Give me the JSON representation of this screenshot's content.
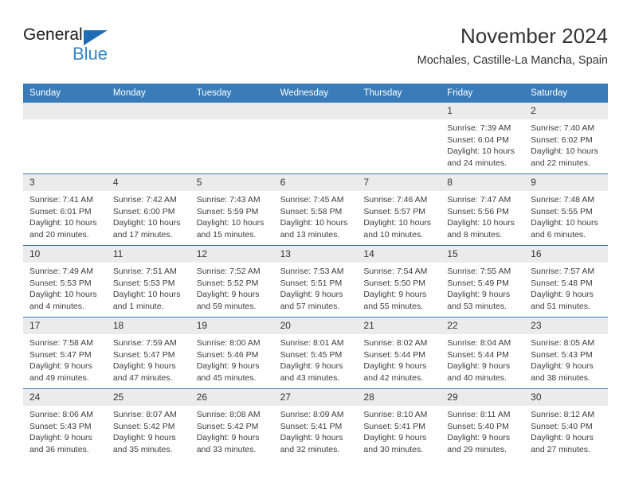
{
  "brand": {
    "name_top": "General",
    "name_bottom": "Blue",
    "accent_dark": "#1f6eb5",
    "accent_light": "#2f86c9"
  },
  "header": {
    "title": "November 2024",
    "subtitle": "Mochales, Castille-La Mancha, Spain"
  },
  "calendar": {
    "header_bg": "#3a7cb8",
    "day_band_bg": "#ebebeb",
    "weekdays": [
      "Sunday",
      "Monday",
      "Tuesday",
      "Wednesday",
      "Thursday",
      "Friday",
      "Saturday"
    ],
    "weeks": [
      [
        {
          "day": "",
          "sunrise": "",
          "sunset": "",
          "daylight": "",
          "empty": true
        },
        {
          "day": "",
          "sunrise": "",
          "sunset": "",
          "daylight": "",
          "empty": true
        },
        {
          "day": "",
          "sunrise": "",
          "sunset": "",
          "daylight": "",
          "empty": true
        },
        {
          "day": "",
          "sunrise": "",
          "sunset": "",
          "daylight": "",
          "empty": true
        },
        {
          "day": "",
          "sunrise": "",
          "sunset": "",
          "daylight": "",
          "empty": true
        },
        {
          "day": "1",
          "sunrise": "Sunrise: 7:39 AM",
          "sunset": "Sunset: 6:04 PM",
          "daylight": "Daylight: 10 hours and 24 minutes."
        },
        {
          "day": "2",
          "sunrise": "Sunrise: 7:40 AM",
          "sunset": "Sunset: 6:02 PM",
          "daylight": "Daylight: 10 hours and 22 minutes."
        }
      ],
      [
        {
          "day": "3",
          "sunrise": "Sunrise: 7:41 AM",
          "sunset": "Sunset: 6:01 PM",
          "daylight": "Daylight: 10 hours and 20 minutes."
        },
        {
          "day": "4",
          "sunrise": "Sunrise: 7:42 AM",
          "sunset": "Sunset: 6:00 PM",
          "daylight": "Daylight: 10 hours and 17 minutes."
        },
        {
          "day": "5",
          "sunrise": "Sunrise: 7:43 AM",
          "sunset": "Sunset: 5:59 PM",
          "daylight": "Daylight: 10 hours and 15 minutes."
        },
        {
          "day": "6",
          "sunrise": "Sunrise: 7:45 AM",
          "sunset": "Sunset: 5:58 PM",
          "daylight": "Daylight: 10 hours and 13 minutes."
        },
        {
          "day": "7",
          "sunrise": "Sunrise: 7:46 AM",
          "sunset": "Sunset: 5:57 PM",
          "daylight": "Daylight: 10 hours and 10 minutes."
        },
        {
          "day": "8",
          "sunrise": "Sunrise: 7:47 AM",
          "sunset": "Sunset: 5:56 PM",
          "daylight": "Daylight: 10 hours and 8 minutes."
        },
        {
          "day": "9",
          "sunrise": "Sunrise: 7:48 AM",
          "sunset": "Sunset: 5:55 PM",
          "daylight": "Daylight: 10 hours and 6 minutes."
        }
      ],
      [
        {
          "day": "10",
          "sunrise": "Sunrise: 7:49 AM",
          "sunset": "Sunset: 5:53 PM",
          "daylight": "Daylight: 10 hours and 4 minutes."
        },
        {
          "day": "11",
          "sunrise": "Sunrise: 7:51 AM",
          "sunset": "Sunset: 5:53 PM",
          "daylight": "Daylight: 10 hours and 1 minute."
        },
        {
          "day": "12",
          "sunrise": "Sunrise: 7:52 AM",
          "sunset": "Sunset: 5:52 PM",
          "daylight": "Daylight: 9 hours and 59 minutes."
        },
        {
          "day": "13",
          "sunrise": "Sunrise: 7:53 AM",
          "sunset": "Sunset: 5:51 PM",
          "daylight": "Daylight: 9 hours and 57 minutes."
        },
        {
          "day": "14",
          "sunrise": "Sunrise: 7:54 AM",
          "sunset": "Sunset: 5:50 PM",
          "daylight": "Daylight: 9 hours and 55 minutes."
        },
        {
          "day": "15",
          "sunrise": "Sunrise: 7:55 AM",
          "sunset": "Sunset: 5:49 PM",
          "daylight": "Daylight: 9 hours and 53 minutes."
        },
        {
          "day": "16",
          "sunrise": "Sunrise: 7:57 AM",
          "sunset": "Sunset: 5:48 PM",
          "daylight": "Daylight: 9 hours and 51 minutes."
        }
      ],
      [
        {
          "day": "17",
          "sunrise": "Sunrise: 7:58 AM",
          "sunset": "Sunset: 5:47 PM",
          "daylight": "Daylight: 9 hours and 49 minutes."
        },
        {
          "day": "18",
          "sunrise": "Sunrise: 7:59 AM",
          "sunset": "Sunset: 5:47 PM",
          "daylight": "Daylight: 9 hours and 47 minutes."
        },
        {
          "day": "19",
          "sunrise": "Sunrise: 8:00 AM",
          "sunset": "Sunset: 5:46 PM",
          "daylight": "Daylight: 9 hours and 45 minutes."
        },
        {
          "day": "20",
          "sunrise": "Sunrise: 8:01 AM",
          "sunset": "Sunset: 5:45 PM",
          "daylight": "Daylight: 9 hours and 43 minutes."
        },
        {
          "day": "21",
          "sunrise": "Sunrise: 8:02 AM",
          "sunset": "Sunset: 5:44 PM",
          "daylight": "Daylight: 9 hours and 42 minutes."
        },
        {
          "day": "22",
          "sunrise": "Sunrise: 8:04 AM",
          "sunset": "Sunset: 5:44 PM",
          "daylight": "Daylight: 9 hours and 40 minutes."
        },
        {
          "day": "23",
          "sunrise": "Sunrise: 8:05 AM",
          "sunset": "Sunset: 5:43 PM",
          "daylight": "Daylight: 9 hours and 38 minutes."
        }
      ],
      [
        {
          "day": "24",
          "sunrise": "Sunrise: 8:06 AM",
          "sunset": "Sunset: 5:43 PM",
          "daylight": "Daylight: 9 hours and 36 minutes."
        },
        {
          "day": "25",
          "sunrise": "Sunrise: 8:07 AM",
          "sunset": "Sunset: 5:42 PM",
          "daylight": "Daylight: 9 hours and 35 minutes."
        },
        {
          "day": "26",
          "sunrise": "Sunrise: 8:08 AM",
          "sunset": "Sunset: 5:42 PM",
          "daylight": "Daylight: 9 hours and 33 minutes."
        },
        {
          "day": "27",
          "sunrise": "Sunrise: 8:09 AM",
          "sunset": "Sunset: 5:41 PM",
          "daylight": "Daylight: 9 hours and 32 minutes."
        },
        {
          "day": "28",
          "sunrise": "Sunrise: 8:10 AM",
          "sunset": "Sunset: 5:41 PM",
          "daylight": "Daylight: 9 hours and 30 minutes."
        },
        {
          "day": "29",
          "sunrise": "Sunrise: 8:11 AM",
          "sunset": "Sunset: 5:40 PM",
          "daylight": "Daylight: 9 hours and 29 minutes."
        },
        {
          "day": "30",
          "sunrise": "Sunrise: 8:12 AM",
          "sunset": "Sunset: 5:40 PM",
          "daylight": "Daylight: 9 hours and 27 minutes."
        }
      ]
    ]
  }
}
